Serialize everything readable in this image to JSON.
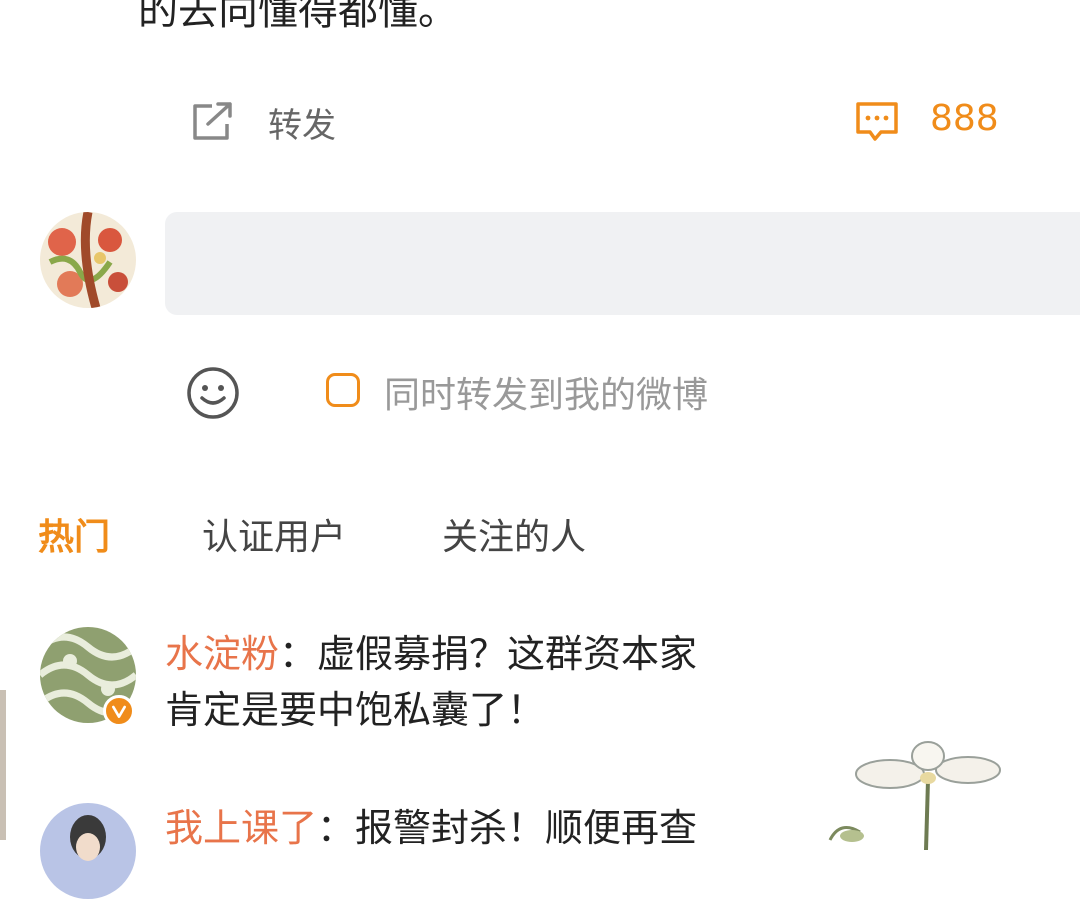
{
  "post": {
    "tail_text": "的去向懂得都懂。"
  },
  "actions": {
    "repost_label": "转发",
    "comment_count": "888",
    "repost_icon": "share-icon",
    "comment_icon": "comment-icon",
    "accent_color": "#f08c1a"
  },
  "composer": {
    "input_value": "",
    "emoji_icon": "smile-icon",
    "also_repost_label": "同时转发到我的微博",
    "also_repost_checked": false
  },
  "tabs": [
    {
      "label": "热门",
      "active": true
    },
    {
      "label": "认证用户",
      "active": false
    },
    {
      "label": "关注的人",
      "active": false
    }
  ],
  "comments": [
    {
      "user": "水淀粉",
      "separator": "：",
      "text_line1": "虚假募捐？这群资本家",
      "text_line2": "肯定是要中饱私囊了！",
      "verified": true
    },
    {
      "user": "我上课了",
      "separator": "：",
      "text_line1": "报警封杀！顺便再查"
    }
  ]
}
